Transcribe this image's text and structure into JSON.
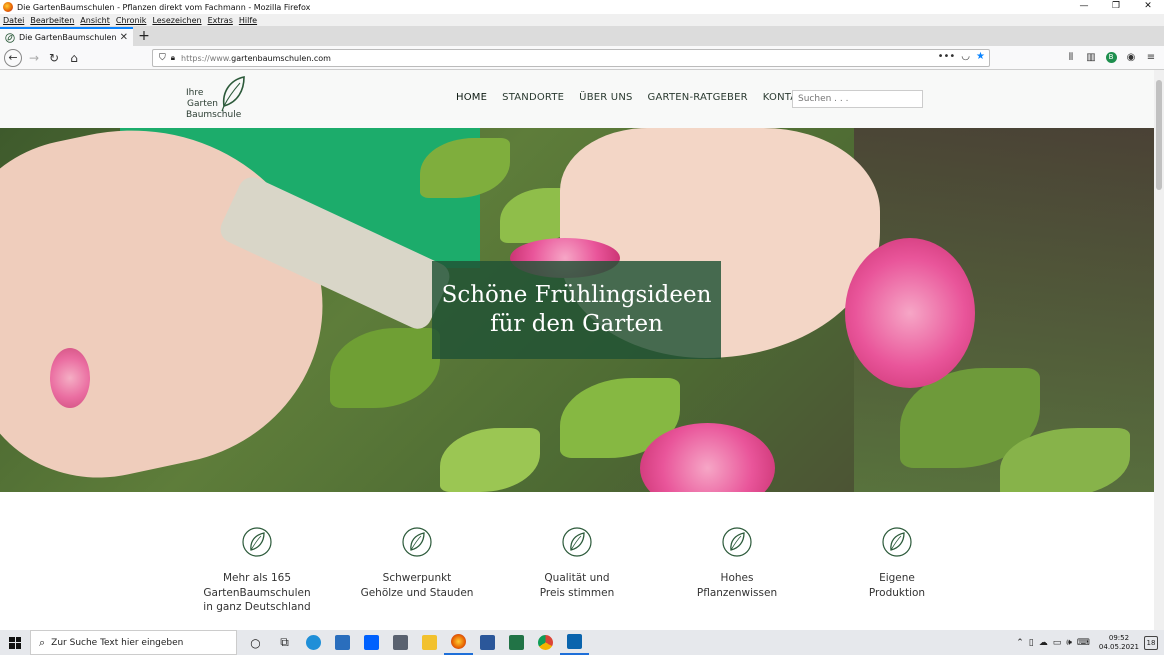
{
  "window": {
    "title": "Die GartenBaumschulen - Pflanzen direkt vom Fachmann - Mozilla Firefox",
    "controls": [
      "—",
      "❐",
      "✕"
    ]
  },
  "menubar": [
    "Datei",
    "Bearbeiten",
    "Ansicht",
    "Chronik",
    "Lesezeichen",
    "Extras",
    "Hilfe"
  ],
  "tab": {
    "label": "Die GartenBaumschulen - Pflan",
    "close": "✕",
    "new": "+"
  },
  "navbar": {
    "url_scheme": "https://www.",
    "url_host": "gartenbaumschulen.com",
    "more": "•••"
  },
  "site": {
    "logo_lines": [
      "Ihre",
      "Garten",
      "Baumschule"
    ],
    "nav": [
      "HOME",
      "STANDORTE",
      "ÜBER UNS",
      "GARTEN-RATGEBER",
      "KONTAKT"
    ],
    "search_placeholder": "Suchen . . .",
    "hero_headline": "Schöne Frühlingsideen für den Garten",
    "features": [
      "Mehr als 165\nGartenBaumschulen\nin ganz Deutschland",
      "Schwerpunkt\nGehölze und Stauden",
      "Qualität und\nPreis stimmen",
      "Hohes\nPflanzenwissen",
      "Eigene\nProduktion"
    ],
    "colors": {
      "hero_box": "#205234",
      "brand_green": "#2c5a3a",
      "accent": "#0a84ff"
    }
  },
  "taskbar": {
    "search_placeholder": "Zur Suche Text hier eingeben",
    "time": "09:52",
    "date": "04.05.2021",
    "notifications": "18"
  }
}
